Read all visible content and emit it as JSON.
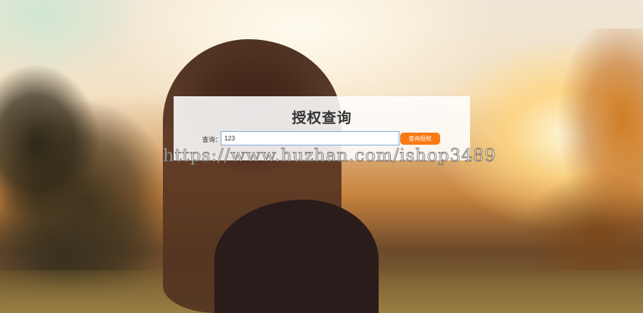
{
  "panel": {
    "title": "授权查询",
    "query_label": "查询：",
    "query_input_value": "123",
    "query_button_label": "查询授权"
  },
  "watermark": {
    "text": "https://www.huzhan.com/ishop3489"
  },
  "colors": {
    "button_bg": "#f97a14",
    "input_border": "#7aa7d8",
    "panel_bg": "rgba(255,255,255,0.88)"
  }
}
